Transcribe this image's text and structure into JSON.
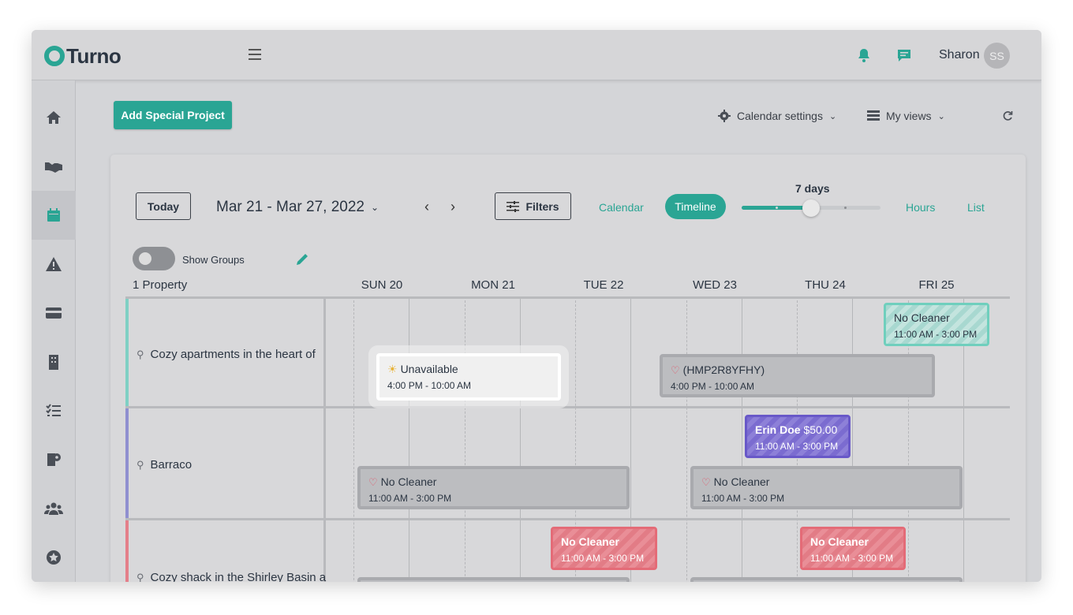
{
  "app": {
    "logo": "Turno"
  },
  "header": {
    "user_name": "Sharon",
    "avatar_initials": "SS"
  },
  "sidebar": {
    "items": [
      "home-icon",
      "handshake-icon",
      "calendar-icon",
      "alert-icon",
      "card-icon",
      "building-icon",
      "checklist-icon",
      "toilet-paper-icon",
      "team-icon",
      "star-icon"
    ]
  },
  "toolbar": {
    "add_button": "Add Special Project",
    "calendar_settings": "Calendar settings",
    "my_views": "My views"
  },
  "calendar": {
    "today": "Today",
    "range": "Mar 21 - Mar 27, 2022",
    "filters": "Filters",
    "views": {
      "calendar": "Calendar",
      "timeline": "Timeline",
      "hours": "Hours",
      "list": "List"
    },
    "zoom_label": "7 days",
    "zoom_level_fraction": 0.5,
    "show_groups": "Show Groups",
    "property_count": "1 Property",
    "days": [
      "SUN 20",
      "MON 21",
      "TUE 22",
      "WED 23",
      "THU 24",
      "FRI 25"
    ]
  },
  "rows": [
    {
      "name": "Cozy apartments in the heart of",
      "color": "#7fd0c4"
    },
    {
      "name": "Barraco",
      "color": "#8f8fd0"
    },
    {
      "name": "Cozy shack in the Shirley Basin a",
      "color": "#e47f8a"
    }
  ],
  "events": {
    "r1_teal": {
      "title": "No Cleaner",
      "time": "11:00 AM - 3:00 PM"
    },
    "r1_unavail": {
      "title": "Unavailable",
      "time": "4:00 PM - 10:00 AM"
    },
    "r1_booking": {
      "title": "(HMP2R8YFHY)",
      "time": "4:00 PM - 10:00 AM"
    },
    "r2_purple": {
      "title": "Erin Doe",
      "price": "$50.00",
      "time": "11:00 AM - 3:00 PM"
    },
    "r2_gray1": {
      "title": "No Cleaner",
      "time": "11:00 AM - 3:00 PM"
    },
    "r2_gray2": {
      "title": "No Cleaner",
      "time": "11:00 AM - 3:00 PM"
    },
    "r3_red1": {
      "title": "No Cleaner",
      "time": "11:00 AM - 3:00 PM"
    },
    "r3_red2": {
      "title": "No Cleaner",
      "time": "11:00 AM - 3:00 PM"
    }
  },
  "colors": {
    "accent": "#2aa594",
    "teal_event": "#6fcfbd",
    "purple_event": "#6858c8",
    "red_event": "#e46b77"
  }
}
